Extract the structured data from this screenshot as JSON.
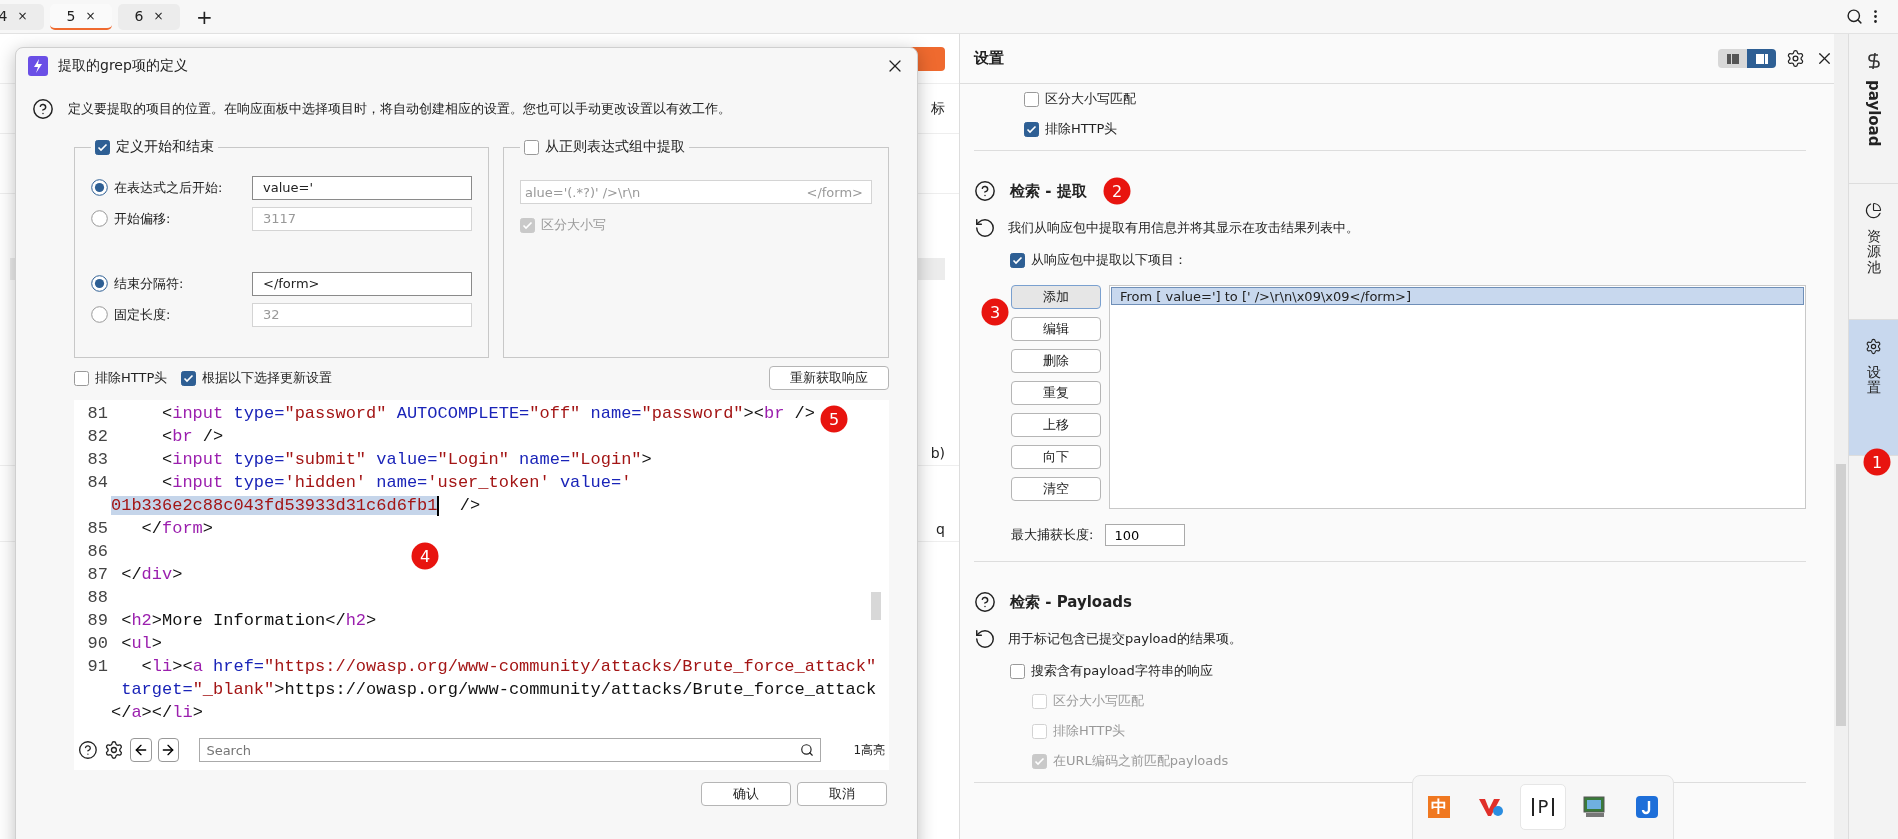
{
  "tab_bar": {
    "tabs": [
      {
        "label": "4",
        "close": "×",
        "selected": false
      },
      {
        "label": "5",
        "close": "×",
        "selected": true
      },
      {
        "label": "6",
        "close": "×",
        "selected": false
      }
    ],
    "add": "+"
  },
  "background": {
    "right_fragments": [
      "标",
      "b)",
      "q"
    ]
  },
  "dialog": {
    "title": "提取的grep项的定义",
    "description": "定义要提取的项目的位置。在响应面板中选择项目时，将自动创建相应的设置。您也可以手动更改设置以有效工作。",
    "start_end_group": {
      "label": "定义开始和结束",
      "checked": true,
      "rows": [
        {
          "label": "在表达式之后开始:",
          "value": "value='",
          "selected": true
        },
        {
          "label": "开始偏移:",
          "value": "3117",
          "selected": false
        },
        {
          "label": "结束分隔符:",
          "value": "</form>",
          "selected": true
        },
        {
          "label": "固定长度:",
          "value": "32",
          "selected": false
        }
      ]
    },
    "regex_group": {
      "label": "从正则表达式组中提取",
      "checked": false,
      "pattern": "alue='(.*?)' />\\r\\n",
      "pattern_end": "</form>",
      "case_label": "区分大小写",
      "case_checked": true
    },
    "options": [
      {
        "label": "排除HTTP头",
        "checked": false
      },
      {
        "label": "根据以下选择更新设置",
        "checked": true
      }
    ],
    "refetch_button": "重新获取响应",
    "code_rows": [
      {
        "number": "81",
        "tokens": [
          {
            "kind": "punct",
            "text": "     <"
          },
          {
            "kind": "tag",
            "text": "input"
          },
          {
            "kind": "attr",
            "text": " type="
          },
          {
            "kind": "value",
            "text": "\"password\""
          },
          {
            "kind": "attr",
            "text": " AUTOCOMPLETE="
          },
          {
            "kind": "value",
            "text": "\"off\""
          },
          {
            "kind": "attr",
            "text": " name="
          },
          {
            "kind": "value",
            "text": "\"password\""
          },
          {
            "kind": "punct",
            "text": "><"
          },
          {
            "kind": "tag",
            "text": "br"
          },
          {
            "kind": "punct",
            "text": " />"
          }
        ]
      },
      {
        "number": "82",
        "tokens": [
          {
            "kind": "punct",
            "text": "     <"
          },
          {
            "kind": "tag",
            "text": "br"
          },
          {
            "kind": "punct",
            "text": " />"
          }
        ]
      },
      {
        "number": "83",
        "tokens": [
          {
            "kind": "punct",
            "text": "     <"
          },
          {
            "kind": "tag",
            "text": "input"
          },
          {
            "kind": "attr",
            "text": " type="
          },
          {
            "kind": "value",
            "text": "\"submit\""
          },
          {
            "kind": "attr",
            "text": " value="
          },
          {
            "kind": "value",
            "text": "\"Login\""
          },
          {
            "kind": "attr",
            "text": " name="
          },
          {
            "kind": "value",
            "text": "\"Login\""
          },
          {
            "kind": "punct",
            "text": ">"
          }
        ]
      },
      {
        "number": "84",
        "tokens": [
          {
            "kind": "punct",
            "text": "     <"
          },
          {
            "kind": "tag",
            "text": "input"
          },
          {
            "kind": "attr",
            "text": " type="
          },
          {
            "kind": "value",
            "text": "'hidden'"
          },
          {
            "kind": "attr",
            "text": " name="
          },
          {
            "kind": "value",
            "text": "'user_token'"
          },
          {
            "kind": "attr",
            "text": " value="
          },
          {
            "kind": "value",
            "text": "'"
          }
        ]
      },
      {
        "tokens": [
          {
            "kind": "selection",
            "text": "01b336e2c88c043fd53933d31c6d6fb1"
          },
          {
            "kind": "cursor"
          },
          {
            "kind": "punct",
            "text": "  />"
          }
        ]
      },
      {
        "number": "85",
        "tokens": [
          {
            "kind": "punct",
            "text": "   </"
          },
          {
            "kind": "tag",
            "text": "form"
          },
          {
            "kind": "punct",
            "text": ">"
          }
        ]
      },
      {
        "number": "86",
        "tokens": []
      },
      {
        "number": "87",
        "tokens": [
          {
            "kind": "punct",
            "text": " </"
          },
          {
            "kind": "tag",
            "text": "div"
          },
          {
            "kind": "punct",
            "text": ">"
          }
        ]
      },
      {
        "number": "88",
        "tokens": []
      },
      {
        "number": "89",
        "tokens": [
          {
            "kind": "punct",
            "text": " <"
          },
          {
            "kind": "tag",
            "text": "h2"
          },
          {
            "kind": "punct",
            "text": ">More Information</"
          },
          {
            "kind": "tag",
            "text": "h2"
          },
          {
            "kind": "punct",
            "text": ">"
          }
        ]
      },
      {
        "number": "90",
        "tokens": [
          {
            "kind": "punct",
            "text": " <"
          },
          {
            "kind": "tag",
            "text": "ul"
          },
          {
            "kind": "punct",
            "text": ">"
          }
        ]
      },
      {
        "number": "91",
        "tokens": [
          {
            "kind": "punct",
            "text": "   <"
          },
          {
            "kind": "tag",
            "text": "li"
          },
          {
            "kind": "punct",
            "text": "><"
          },
          {
            "kind": "tag",
            "text": "a"
          },
          {
            "kind": "attr",
            "text": " href="
          },
          {
            "kind": "value",
            "text": "\"https://owasp.org/www-community/attacks/Brute_force_attack\""
          }
        ]
      },
      {
        "tokens": [
          {
            "kind": "attr",
            "text": " target="
          },
          {
            "kind": "value",
            "text": "\"_blank\""
          },
          {
            "kind": "punct",
            "text": ">https://owasp.org/www-community/attacks/Brute_force_attack"
          }
        ]
      },
      {
        "tokens": [
          {
            "kind": "punct",
            "text": "</"
          },
          {
            "kind": "tag",
            "text": "a"
          },
          {
            "kind": "punct",
            "text": "></"
          },
          {
            "kind": "tag",
            "text": "li"
          },
          {
            "kind": "punct",
            "text": ">"
          }
        ]
      }
    ],
    "search": {
      "placeholder": "Search",
      "count": "1高亮"
    },
    "buttons": [
      "确认",
      "取消"
    ]
  },
  "settings_panel": {
    "title": "设置",
    "view_toggle": [
      {
        "selected": false
      },
      {
        "selected": true
      }
    ],
    "top_checks": [
      {
        "label": "区分大小写匹配",
        "checked": false
      },
      {
        "label": "排除HTTP头",
        "checked": true
      }
    ],
    "extract": {
      "title": "检索 - 提取",
      "description": "我们从响应包中提取有用信息并将其显示在攻击结果列表中。",
      "enable": {
        "label": "从响应包中提取以下项目：",
        "checked": true
      },
      "buttons": [
        {
          "label": "添加",
          "focused": true
        },
        {
          "label": "编辑",
          "focused": false
        },
        {
          "label": "删除",
          "focused": false
        },
        {
          "label": "重复",
          "focused": false
        },
        {
          "label": "上移",
          "focused": false
        },
        {
          "label": "向下",
          "focused": false
        },
        {
          "label": "清空",
          "focused": false
        }
      ],
      "items": [
        {
          "text": "From [ value='] to [' />\\r\\n\\x09\\x09</form>]",
          "selected": true
        }
      ],
      "max_length_label": "最大捕获长度:",
      "max_length": "100"
    },
    "payloads": {
      "title": "检索 - Payloads",
      "description": "用于标记包含已提交payload的结果项。",
      "checks": [
        {
          "label": "搜索含有payload字符串的响应",
          "checked": false,
          "disabled": false,
          "children": [
            {
              "label": "区分大小写匹配",
              "checked": false,
              "disabled": true
            },
            {
              "label": "排除HTTP头",
              "checked": false,
              "disabled": true
            },
            {
              "label": "在URL编码之前匹配payloads",
              "checked": true,
              "disabled": true
            }
          ]
        }
      ]
    }
  },
  "sidebar": {
    "items": [
      {
        "label": "payload",
        "kind": "latin",
        "selected": false
      },
      {
        "label": "资源池",
        "kind": "cjk",
        "selected": false
      },
      {
        "label": "设置",
        "kind": "cjk",
        "selected": true
      }
    ]
  },
  "taskbar": {
    "items": [
      {
        "kind": "ime",
        "text": "中"
      },
      {
        "kind": "logo"
      },
      {
        "kind": "snip",
        "text": "P"
      },
      {
        "kind": "monitor"
      },
      {
        "kind": "app"
      }
    ]
  },
  "annotations": [
    {
      "text": "1"
    },
    {
      "text": "2"
    },
    {
      "text": "3"
    },
    {
      "text": "4"
    },
    {
      "text": "5"
    }
  ]
}
